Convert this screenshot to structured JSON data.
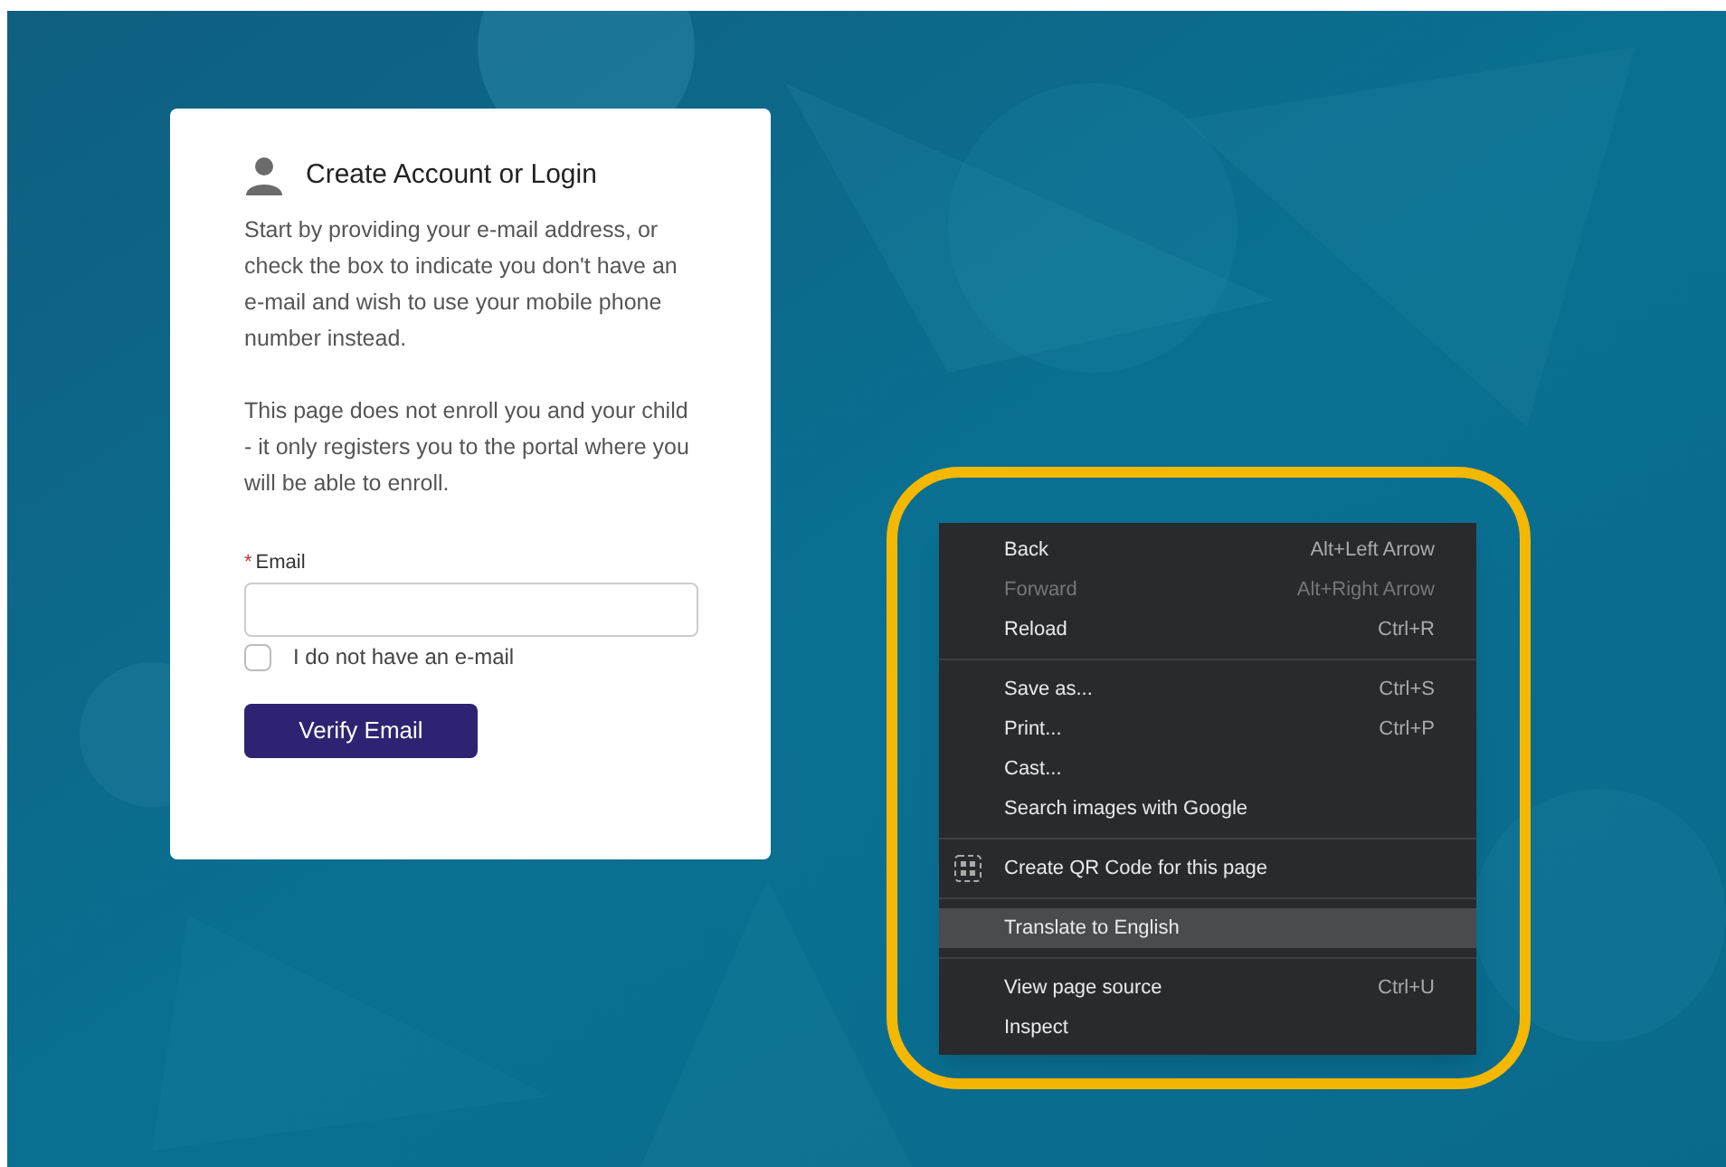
{
  "login_card": {
    "title": "Create Account or Login",
    "paragraphs": [
      "Start by providing your e-mail address, or check the box to indicate you don't have an e-mail and wish to use your mobile phone number instead.",
      "This page does not enroll you and your child - it only registers you to the portal where you will be able to enroll."
    ],
    "email_field": {
      "required_mark": "*",
      "label": "Email"
    },
    "no_email_checkbox": {
      "label": "I do not have an e-mail",
      "checked": false
    },
    "verify_button": "Verify Email"
  },
  "context_menu": {
    "highlighted_ring": true,
    "groups": [
      [
        {
          "label": "Back",
          "shortcut": "Alt+Left Arrow",
          "disabled": false,
          "selected": false
        },
        {
          "label": "Forward",
          "shortcut": "Alt+Right Arrow",
          "disabled": true,
          "selected": false
        },
        {
          "label": "Reload",
          "shortcut": "Ctrl+R",
          "disabled": false,
          "selected": false
        }
      ],
      [
        {
          "label": "Save as...",
          "shortcut": "Ctrl+S",
          "disabled": false,
          "selected": false
        },
        {
          "label": "Print...",
          "shortcut": "Ctrl+P",
          "disabled": false,
          "selected": false
        },
        {
          "label": "Cast...",
          "disabled": false,
          "selected": false
        },
        {
          "label": "Search images with Google",
          "disabled": false,
          "selected": false
        }
      ],
      [
        {
          "label": "Create QR Code for this page",
          "kind": "qr",
          "disabled": false,
          "selected": false
        }
      ],
      [
        {
          "label": "Translate to English",
          "disabled": false,
          "selected": true
        }
      ],
      [
        {
          "label": "View page source",
          "shortcut": "Ctrl+U",
          "disabled": false,
          "selected": false
        },
        {
          "label": "Inspect",
          "disabled": false,
          "selected": false
        }
      ]
    ]
  }
}
